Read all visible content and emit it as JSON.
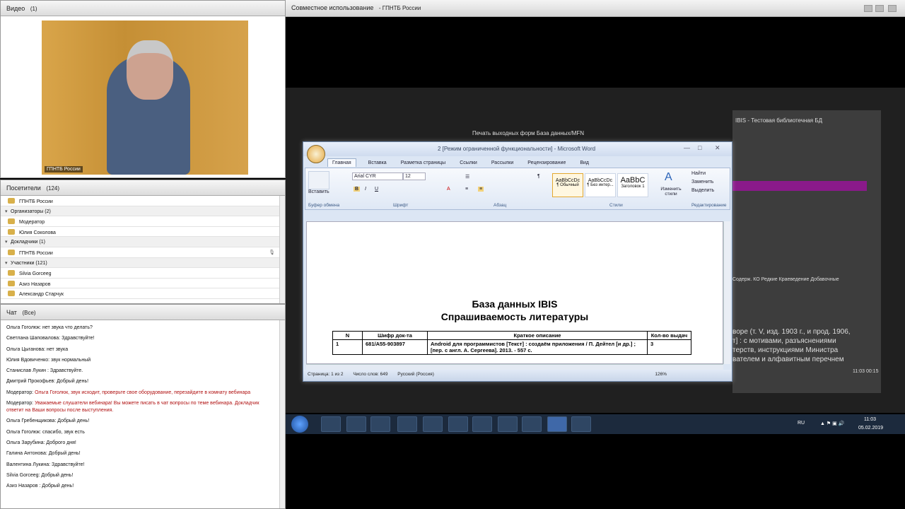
{
  "video": {
    "title": "Видео",
    "count": "(1)",
    "name_tag": "ГПНТБ России"
  },
  "attendees": {
    "title": "Посетители",
    "count": "(124)",
    "rows": [
      {
        "label": "ГПНТБ России",
        "kind": "item"
      },
      {
        "label": "Организаторы (2)",
        "kind": "group"
      },
      {
        "label": "Модератор",
        "kind": "item"
      },
      {
        "label": "Юлия Соколова",
        "kind": "item"
      },
      {
        "label": "Докладчики (1)",
        "kind": "group"
      },
      {
        "label": "ГПНТБ России",
        "kind": "item"
      },
      {
        "label": "Участники (121)",
        "kind": "group"
      },
      {
        "label": "Silvia Gorceeg",
        "kind": "item"
      },
      {
        "label": "Азиз Назаров",
        "kind": "item"
      },
      {
        "label": "Александр Старчук",
        "kind": "item"
      }
    ]
  },
  "chat": {
    "title": "Чат",
    "scope": "(Все)",
    "messages": [
      {
        "author": "Ольга Гоголюк:",
        "text": " нет звука что делать?",
        "red": false
      },
      {
        "author": "Светлана Шаповалова:",
        "text": " Здравствуйте!",
        "red": false
      },
      {
        "author": "Ольга Цыганова:",
        "text": " нет звука",
        "red": false
      },
      {
        "author": "Юлия Вдовиченко:",
        "text": " звук нормальный",
        "red": false
      },
      {
        "author": "Станислав Лукин :",
        "text": " Здравствуйте.",
        "red": false
      },
      {
        "author": "Дмитрий Прокофьев:",
        "text": " Добрый день!",
        "red": false
      },
      {
        "author": "Модератор:",
        "text": " Ольга Гоголюк, звук исходит, проверьте свое оборудование, перезайдите в комнату вебинара",
        "red": true
      },
      {
        "author": "Модератор:",
        "text": " Уважаемые слушатели вебинара! Вы можете писать в чат вопросы по теме вебинара. Докладчик ответит на Ваши вопросы после выступления.",
        "red": true
      },
      {
        "author": "Ольга Гребенщикова:",
        "text": " Добрый день!",
        "red": false
      },
      {
        "author": "Ольга Гоголюк:",
        "text": " спасибо, звук есть",
        "red": false
      },
      {
        "author": "Ольга Зарубина:",
        "text": " Доброго дня!",
        "red": false
      },
      {
        "author": "Галина Антонова:",
        "text": " Добрый день!",
        "red": false
      },
      {
        "author": "Валентина Лукина:",
        "text": " Здравствуйте!",
        "red": false
      },
      {
        "author": "Silvia Gorceeg:",
        "text": " Добрый день!",
        "red": false
      },
      {
        "author": "Азиз Назаров :",
        "text": " Добрый день!",
        "red": false
      }
    ]
  },
  "share": {
    "title": "Совместное использование",
    "subtitle": "- ГПНТБ России"
  },
  "word": {
    "title": "2 [Режим ограниченной функциональности] - Microsoft Word",
    "tabs": [
      "Главная",
      "Вставка",
      "Разметка страницы",
      "Ссылки",
      "Рассылки",
      "Рецензирование",
      "Вид"
    ],
    "font_name": "Arial CYR",
    "font_size": "12",
    "paste": "Вставить",
    "styles": [
      "AaBbCcDc",
      "AaBbCcDc",
      "AaBbC"
    ],
    "style_names": [
      "¶ Обычный",
      "¶ Без интер...",
      "Заголовок 1"
    ],
    "change_styles": "Изменить стили",
    "find": "Найти",
    "replace": "Заменить",
    "select": "Выделить",
    "groups": [
      "Буфер обмена",
      "Шрифт",
      "Абзац",
      "Стили",
      "Редактирование"
    ],
    "doc_title1": "База данных    IBIS",
    "doc_title2": "Спрашиваемость литературы",
    "table_headers": [
      "N",
      "Шифр док-та",
      "Краткое описание",
      "Кол-во выдач"
    ],
    "table_row": [
      "1",
      "681/А55-903897",
      "Android для программистов [Текст] : создаём приложения / П. Дейтел [и др.] ; [пер. с англ. А. Сергеева]. 2013. - 557 с.",
      "3"
    ],
    "status": [
      "Страница: 1 из 2",
      "Число слов: 649",
      "Русский (Россия)"
    ],
    "zoom": "126%"
  },
  "background": {
    "ibis_title": "IBIS - Тестовая библиотечная БД",
    "print_window": "Печать выходных форм  База данных/MFN",
    "side_text_1": "ворe (т. V, изд. 1903 г., и прод. 1906,",
    "side_text_2": "т] : с мотивами, разъяснениями",
    "side_text_3": "терств, инструкциями Министра",
    "side_text_4": "вателем и алфавитным перечнем",
    "tabs_line": "Содерж.  КО  Редкие  Краеведение  Добавочные",
    "time_cell": "11:03  00:15"
  },
  "taskbar": {
    "lang": "RU",
    "time": "11:03",
    "date": "05.02.2019"
  },
  "colors": {
    "accent_red": "#b01010",
    "word_blue": "#dce6f4"
  }
}
